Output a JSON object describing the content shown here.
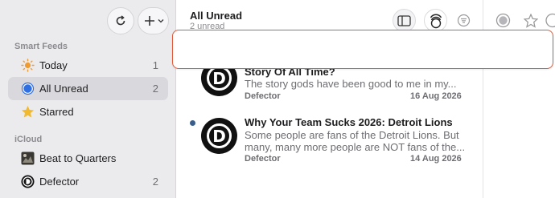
{
  "sidebar": {
    "sections": [
      {
        "label": "Smart Feeds"
      },
      {
        "label": "iCloud"
      }
    ],
    "items": [
      {
        "label": "Today",
        "count": "1"
      },
      {
        "label": "All Unread",
        "count": "2"
      },
      {
        "label": "Starred",
        "count": ""
      },
      {
        "label": "Beat to Quarters",
        "count": ""
      },
      {
        "label": "Defector",
        "count": "2"
      }
    ]
  },
  "timeline": {
    "title": "All Unread",
    "subtitle": "2 unread",
    "articles": [
      {
        "avatar_letter": "D",
        "title": "Story Of All Time?",
        "summary_lines": [
          "The story gods have been good to me in my..."
        ],
        "source": "Defector",
        "date": "16 Aug 2026",
        "unread": false
      },
      {
        "avatar_letter": "D",
        "title": "Why Your Team Sucks 2026: Detroit Lions",
        "summary_lines": [
          "Some people are fans of the Detroit Lions. But",
          "many, many more people are NOT fans of the..."
        ],
        "source": "Defector",
        "date": "14 Aug 2026",
        "unread": true
      }
    ]
  },
  "icons": {
    "refresh": "refresh-icon",
    "add": "plus-icon",
    "sidebar_toggle": "sidebar-toggle-icon",
    "mark_all_read": "mark-all-read-icon",
    "filter": "filter-icon",
    "read_status": "circle-icon",
    "star": "star-icon"
  },
  "colors": {
    "accent": "#2f6fe0",
    "sun": "#f19a2d",
    "star": "#f2b82e",
    "unread_dot": "#3a5e8c",
    "highlight_border": "#e05a3a"
  }
}
